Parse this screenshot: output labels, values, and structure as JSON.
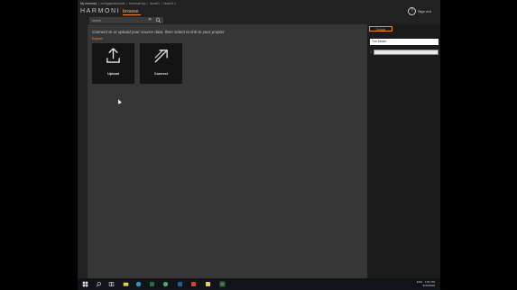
{
  "breadcrumb": [
    "My Inventory",
    "mortgageabsorpab",
    "Harvester3yy",
    "Nuds01",
    "Nuds01 s"
  ],
  "app": {
    "logo": "HARMONI",
    "nav_browse": "browse",
    "sign_out": "Sign out",
    "help_icon": "question-icon"
  },
  "search": {
    "placeholder": "search",
    "clear": "✕"
  },
  "main": {
    "intro": "Connect to or upload your source data, then select to link to your project",
    "hint": "Expand",
    "tiles": [
      {
        "label": "Upload",
        "icon": "upload-icon"
      },
      {
        "label": "Connect",
        "icon": "connect-arrow-icon"
      }
    ]
  },
  "right_panel": {
    "details_button": "Details",
    "name_field_value": "The Meaer",
    "bullet": "1"
  },
  "taskbar": {
    "icons": [
      "windows-start-icon",
      "search-icon",
      "task-view-icon",
      "explorer-icon",
      "skype-icon",
      "excel-icon",
      "chrome-icon",
      "outlook-icon",
      "powerpoint-icon",
      "notes-icon",
      "harmoni-icon"
    ],
    "tray": {
      "lang": "ENG",
      "time": "1:51 PM",
      "date": "6/30/2018"
    }
  },
  "colors": {
    "accent": "#f28c28",
    "app_bg": "#212121",
    "panel_bg": "#363636"
  }
}
